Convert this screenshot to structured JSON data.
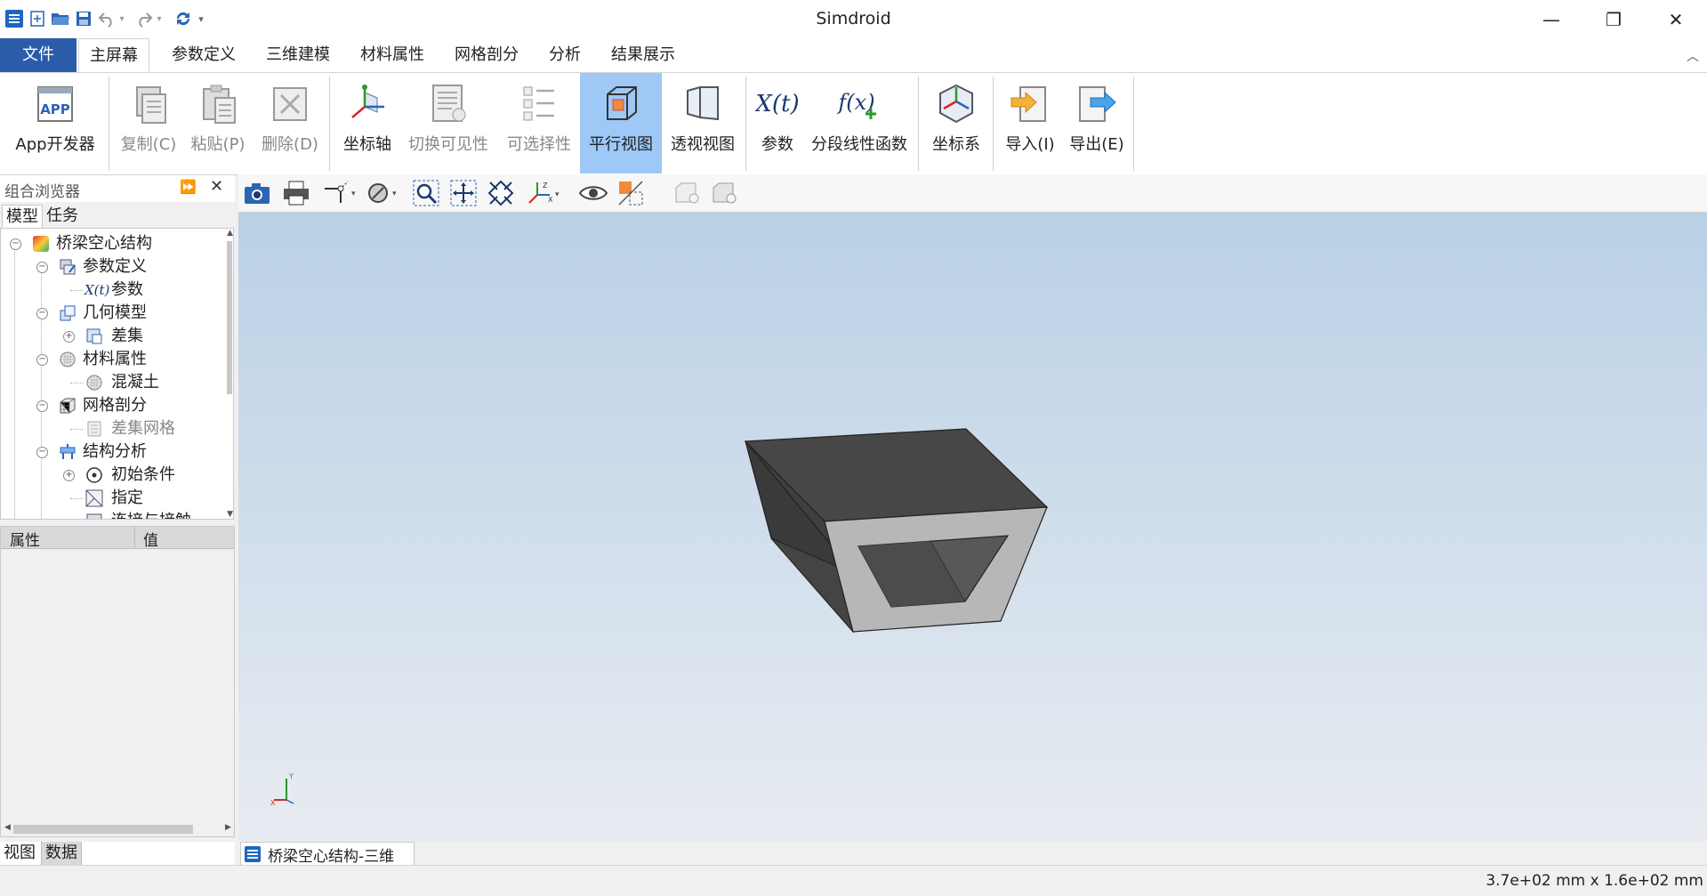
{
  "window": {
    "title": "Simdroid",
    "minimize": "—",
    "restore": "❐",
    "close": "✕"
  },
  "menu": {
    "items": [
      "文件",
      "主屏幕",
      "参数定义",
      "三维建模",
      "材料属性",
      "网格剖分",
      "分析",
      "结果展示"
    ],
    "active": "主屏幕"
  },
  "ribbon": {
    "buttons": [
      {
        "label": "App开发器",
        "icon": "app-icon",
        "enabled": true
      },
      {
        "label": "复制(C)",
        "icon": "copy-icon",
        "enabled": false
      },
      {
        "label": "粘贴(P)",
        "icon": "paste-icon",
        "enabled": false
      },
      {
        "label": "删除(D)",
        "icon": "delete-icon",
        "enabled": false
      },
      {
        "label": "坐标轴",
        "icon": "axis-icon",
        "enabled": true
      },
      {
        "label": "切换可见性",
        "icon": "visibility-icon",
        "enabled": false
      },
      {
        "label": "可选择性",
        "icon": "selectability-icon",
        "enabled": false
      },
      {
        "label": "平行视图",
        "icon": "parallel-view-icon",
        "enabled": true,
        "selected": true
      },
      {
        "label": "透视视图",
        "icon": "perspective-view-icon",
        "enabled": true
      },
      {
        "label": "参数",
        "icon": "parameter-icon",
        "enabled": true
      },
      {
        "label": "分段线性函数",
        "icon": "piecewise-function-icon",
        "enabled": true
      },
      {
        "label": "坐标系",
        "icon": "coordinate-system-icon",
        "enabled": true
      },
      {
        "label": "导入(I)",
        "icon": "import-icon",
        "enabled": true
      },
      {
        "label": "导出(E)",
        "icon": "export-icon",
        "enabled": true
      }
    ]
  },
  "left_panel": {
    "title": "组合浏览器",
    "top_tabs": [
      "模型",
      "任务"
    ],
    "tree": [
      {
        "label": "桥梁空心结构",
        "level": 0,
        "expander": "−",
        "icon": "model-root-icon"
      },
      {
        "label": "参数定义",
        "level": 1,
        "expander": "−",
        "icon": "parameter-definition-icon"
      },
      {
        "label": "参数",
        "level": 2,
        "expander": "",
        "icon": "parameter-icon",
        "icon_text": "X(t)"
      },
      {
        "label": "几何模型",
        "level": 1,
        "expander": "−",
        "icon": "geometry-icon"
      },
      {
        "label": "差集",
        "level": 2,
        "expander": "+",
        "icon": "difference-icon"
      },
      {
        "label": "材料属性",
        "level": 1,
        "expander": "−",
        "icon": "material-icon"
      },
      {
        "label": "混凝土",
        "level": 2,
        "expander": "",
        "icon": "concrete-icon"
      },
      {
        "label": "网格剖分",
        "level": 1,
        "expander": "−",
        "icon": "mesh-icon"
      },
      {
        "label": "差集网格",
        "level": 2,
        "expander": "",
        "icon": "mesh-item-icon",
        "dim": true
      },
      {
        "label": "结构分析",
        "level": 1,
        "expander": "−",
        "icon": "analysis-icon"
      },
      {
        "label": "初始条件",
        "level": 2,
        "expander": "+",
        "icon": "initial-condition-icon"
      },
      {
        "label": "指定",
        "level": 2,
        "expander": "",
        "icon": "assign-icon"
      },
      {
        "label": "连接与接触",
        "level": 2,
        "expander": "",
        "icon": "contact-icon"
      }
    ],
    "props_headers": [
      "属性",
      "值"
    ],
    "bottom_tabs": [
      "视图",
      "数据"
    ]
  },
  "viewer": {
    "toolbar_icons": [
      "camera-icon",
      "print-icon",
      "axis-dropdown-icon",
      "draw-style-icon",
      "zoom-box-icon",
      "fit-all-icon",
      "fit-selection-icon",
      "view-axes-icon",
      "show-eye-icon",
      "section-icon",
      "light-box-icon",
      "light-box-2-icon"
    ],
    "doc_tab": "桥梁空心结构-三维",
    "axis_labels": {
      "x": "X",
      "y": "Y"
    }
  },
  "status": {
    "dimensions": "3.7e+02 mm x 1.6e+02 mm"
  },
  "colors": {
    "accent": "#2a5caa",
    "selected": "#9ec8f5",
    "model_dark": "#3c3c3c",
    "model_face": "#b5b5b5"
  }
}
